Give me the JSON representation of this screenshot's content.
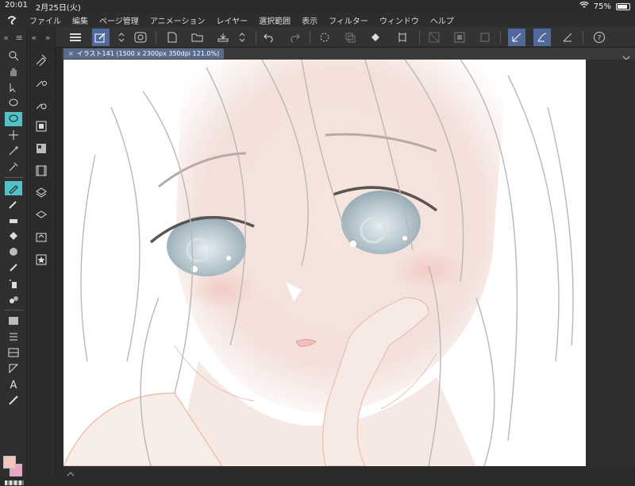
{
  "status": {
    "time": "20:01",
    "date": "2月25日(火)",
    "battery": "75%",
    "battery_level": 0.75
  },
  "menu": [
    "ファイル",
    "編集",
    "ページ管理",
    "アニメーション",
    "レイヤー",
    "選択範囲",
    "表示",
    "フィルター",
    "ウィンドウ",
    "ヘルプ"
  ],
  "document": {
    "tab_label": "イラスト141 (1500 x 2300px 350dpi 121.0%)"
  },
  "colors": {
    "accent": "#53c1c7",
    "active_toolbar": "#4f6a9a",
    "main_color": "#f2c6bd",
    "sub_color": "#e9a6c5"
  },
  "canvas": {
    "description_icon": "illustration-canvas"
  },
  "left_tools": [
    "zoom-icon",
    "hand-icon",
    "rotate-icon",
    "lasso-icon",
    "selection-icon",
    "move-icon",
    "magic-wand-icon",
    "eyedropper-icon",
    "pen-icon",
    "pencil-icon",
    "eraser-icon",
    "fill-icon",
    "pattern-icon",
    "correction-icon",
    "spray-icon",
    "blend-icon",
    "gradient-icon",
    "lines-icon",
    "frame-icon",
    "ruler-icon",
    "text-icon",
    "balloon-icon"
  ],
  "sub_tools": [
    "sub-tool-1",
    "sub-tool-2",
    "sub-tool-3",
    "sub-tool-4",
    "sub-tool-5",
    "sub-tool-6",
    "sub-tool-7",
    "sub-tool-8",
    "sub-tool-9",
    "sub-tool-10"
  ]
}
